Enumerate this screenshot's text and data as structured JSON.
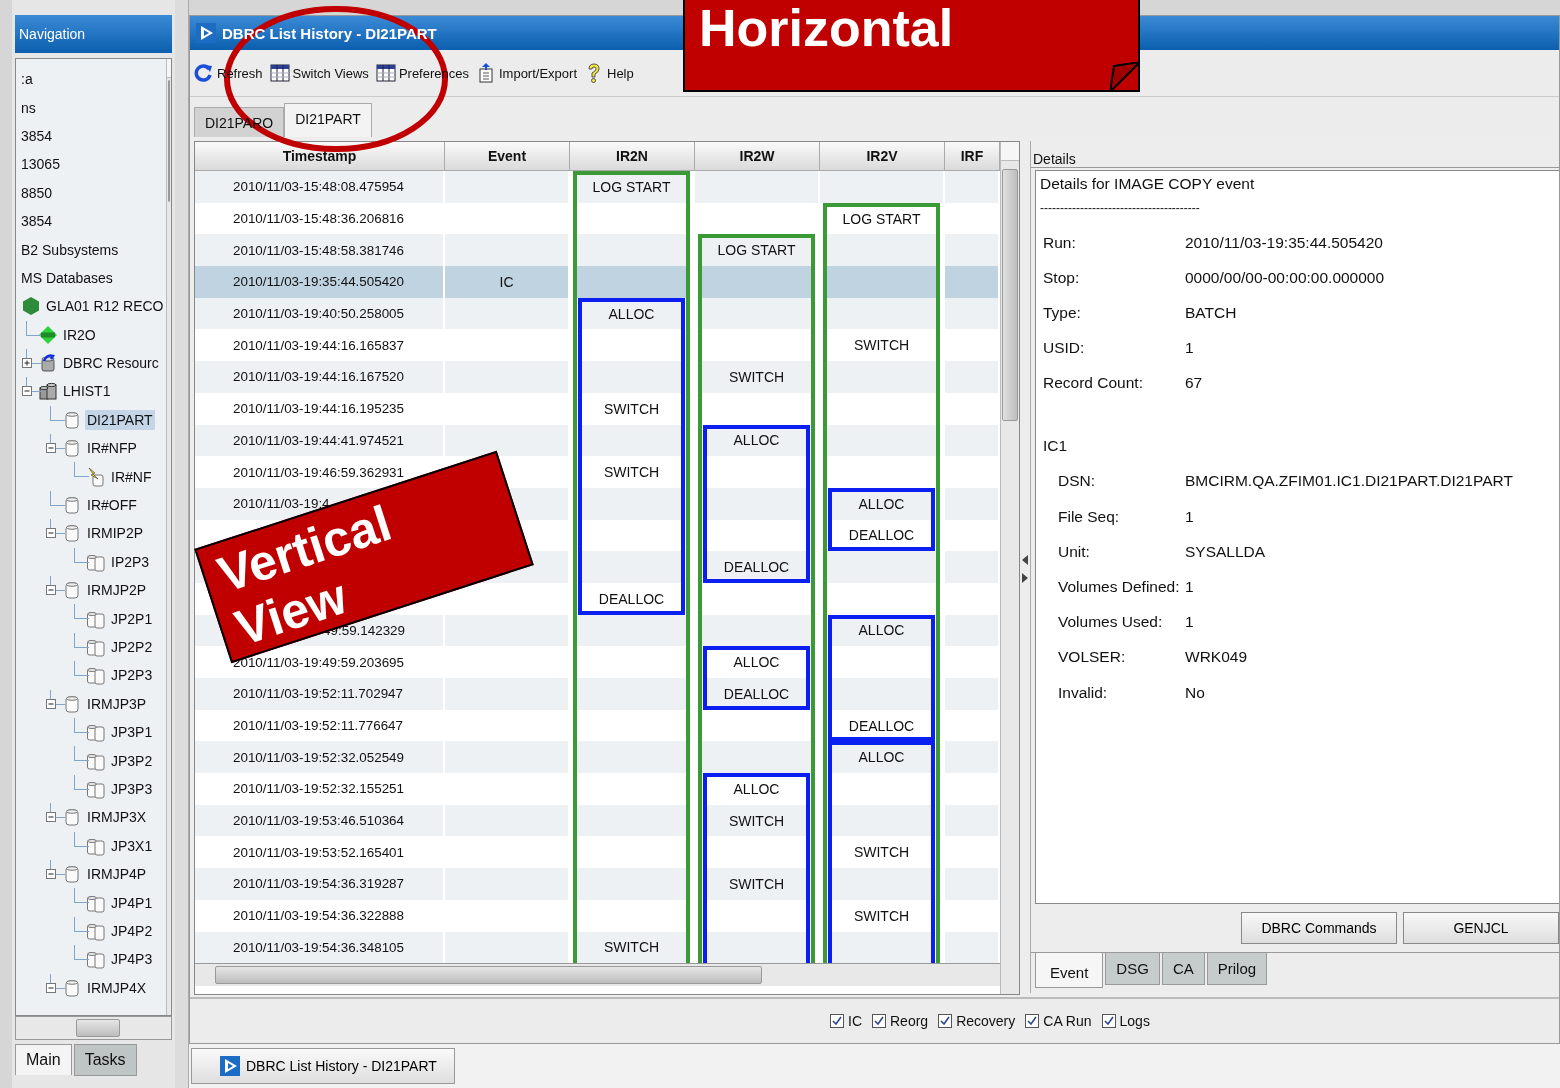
{
  "navigation": {
    "title": "Navigation",
    "tree": [
      {
        "label": ":a",
        "kind": "plain",
        "selected": false
      },
      {
        "label": "ns",
        "kind": "plain",
        "selected": false
      },
      {
        "label": "3854",
        "kind": "plain",
        "selected": false
      },
      {
        "label": "13065",
        "kind": "plain",
        "selected": false
      },
      {
        "label": "8850",
        "kind": "plain",
        "selected": false
      },
      {
        "label": "3854",
        "kind": "plain",
        "selected": false
      },
      {
        "label": "B2 Subsystems",
        "kind": "plain",
        "selected": false
      },
      {
        "label": "MS Databases",
        "kind": "plain",
        "selected": false
      },
      {
        "label": "GLA01 R12 RECO",
        "kind": "recon",
        "selected": false,
        "children": [
          {
            "label": "IR2O",
            "kind": "ims",
            "selected": false
          },
          {
            "label": "DBRC Resourc",
            "kind": "resource",
            "selected": false,
            "expanded": false
          },
          {
            "label": "LHIST1",
            "kind": "history",
            "selected": false,
            "expanded": true,
            "children": [
              {
                "label": "DI21PART",
                "kind": "database",
                "selected": true
              },
              {
                "label": "IR#NFP",
                "kind": "database",
                "selected": false,
                "expanded": true,
                "children": [
                  {
                    "label": "IR#NF",
                    "kind": "alert",
                    "selected": false
                  }
                ]
              },
              {
                "label": "IR#OFF",
                "kind": "database",
                "selected": false
              },
              {
                "label": "IRMIP2P",
                "kind": "database",
                "selected": false,
                "expanded": true,
                "children": [
                  {
                    "label": "IP2P3",
                    "kind": "dbset",
                    "selected": false
                  }
                ]
              },
              {
                "label": "IRMJP2P",
                "kind": "database",
                "selected": false,
                "expanded": true,
                "children": [
                  {
                    "label": "JP2P1",
                    "kind": "dbset",
                    "selected": false
                  },
                  {
                    "label": "JP2P2",
                    "kind": "dbset",
                    "selected": false
                  },
                  {
                    "label": "JP2P3",
                    "kind": "dbset",
                    "selected": false
                  }
                ]
              },
              {
                "label": "IRMJP3P",
                "kind": "database",
                "selected": false,
                "expanded": true,
                "children": [
                  {
                    "label": "JP3P1",
                    "kind": "dbset",
                    "selected": false
                  },
                  {
                    "label": "JP3P2",
                    "kind": "dbset",
                    "selected": false
                  },
                  {
                    "label": "JP3P3",
                    "kind": "dbset",
                    "selected": false
                  }
                ]
              },
              {
                "label": "IRMJP3X",
                "kind": "database",
                "selected": false,
                "expanded": true,
                "children": [
                  {
                    "label": "JP3X1",
                    "kind": "dbset",
                    "selected": false
                  }
                ]
              },
              {
                "label": "IRMJP4P",
                "kind": "database",
                "selected": false,
                "expanded": true,
                "children": [
                  {
                    "label": "JP4P1",
                    "kind": "dbset",
                    "selected": false
                  },
                  {
                    "label": "JP4P2",
                    "kind": "dbset",
                    "selected": false
                  },
                  {
                    "label": "JP4P3",
                    "kind": "dbset",
                    "selected": false
                  }
                ]
              },
              {
                "label": "IRMJP4X",
                "kind": "database",
                "selected": false,
                "expanded": true
              }
            ]
          }
        ]
      }
    ],
    "tabs": [
      {
        "label": "Main",
        "selected": true
      },
      {
        "label": "Tasks",
        "selected": false
      }
    ]
  },
  "window": {
    "title": "DBRC List History - DI21PART"
  },
  "toolbar": [
    {
      "label": "Refresh",
      "kind": "refresh"
    },
    {
      "label": "Switch Views",
      "kind": "views"
    },
    {
      "label": "Preferences",
      "kind": "preferences"
    },
    {
      "label": "Import/Export",
      "kind": "export"
    },
    {
      "label": "Help",
      "kind": "help"
    }
  ],
  "tabs": [
    {
      "label": "DI21PARO",
      "selected": false
    },
    {
      "label": "DI21PART",
      "selected": true
    }
  ],
  "table": {
    "columns": [
      "Timestamp",
      "Event",
      "IR2N",
      "IR2W",
      "IR2V",
      "IRF"
    ],
    "rows": [
      {
        "timestamp": "2010/11/03-15:48:08.475954",
        "selected": false
      },
      {
        "timestamp": "2010/11/03-15:48:36.206816",
        "selected": false
      },
      {
        "timestamp": "2010/11/03-15:48:58.381746",
        "selected": false
      },
      {
        "timestamp": "2010/11/03-19:35:44.505420",
        "event": "IC",
        "selected": true
      },
      {
        "timestamp": "2010/11/03-19:40:50.258005",
        "selected": false
      },
      {
        "timestamp": "2010/11/03-19:44:16.165837",
        "selected": false
      },
      {
        "timestamp": "2010/11/03-19:44:16.167520",
        "selected": false
      },
      {
        "timestamp": "2010/11/03-19:44:16.195235",
        "selected": false
      },
      {
        "timestamp": "2010/11/03-19:44:41.974521",
        "selected": false
      },
      {
        "timestamp": "2010/11/03-19:46:59.362931",
        "selected": false
      },
      {
        "timestamp": "2010/11/03-19:4",
        "selected": false
      },
      {
        "kind": "hidden"
      },
      {
        "kind": "hidden"
      },
      {
        "kind": "hidden"
      },
      {
        "timestamp": "49:59.142329",
        "kind": "tail",
        "selected": false
      },
      {
        "timestamp": "2010/11/03-19:49:59.203695",
        "selected": false
      },
      {
        "timestamp": "2010/11/03-19:52:11.702947",
        "selected": false
      },
      {
        "timestamp": "2010/11/03-19:52:11.776647",
        "selected": false
      },
      {
        "timestamp": "2010/11/03-19:52:32.052549",
        "selected": false
      },
      {
        "timestamp": "2010/11/03-19:52:32.155251",
        "selected": false
      },
      {
        "timestamp": "2010/11/03-19:53:46.510364",
        "selected": false
      },
      {
        "timestamp": "2010/11/03-19:53:52.165401",
        "selected": false
      },
      {
        "timestamp": "2010/11/03-19:54:36.319287",
        "selected": false
      },
      {
        "timestamp": "2010/11/03-19:54:36.322888",
        "selected": false
      },
      {
        "timestamp": "2010/11/03-19:54:36.348105",
        "selected": false
      }
    ],
    "lanes": [
      {
        "items": [
          {
            "kind": "log",
            "continues": true,
            "items": [
              {
                "kind": "event",
                "text": "LOG START"
              },
              {
                "kind": "empty"
              },
              {
                "kind": "empty"
              },
              {
                "kind": "empty"
              },
              {
                "kind": "alloc",
                "continues": false,
                "items": [
                  {
                    "kind": "event",
                    "text": "ALLOC"
                  },
                  {
                    "kind": "empty"
                  },
                  {
                    "kind": "empty"
                  },
                  {
                    "kind": "event",
                    "text": "SWITCH"
                  },
                  {
                    "kind": "empty"
                  },
                  {
                    "kind": "event",
                    "text": "SWITCH"
                  },
                  {
                    "kind": "empty"
                  },
                  {
                    "kind": "empty"
                  },
                  {
                    "kind": "empty"
                  },
                  {
                    "kind": "event",
                    "text": "DEALLOC"
                  }
                ]
              },
              {
                "kind": "empty"
              },
              {
                "kind": "empty"
              },
              {
                "kind": "empty"
              },
              {
                "kind": "empty"
              },
              {
                "kind": "empty"
              },
              {
                "kind": "empty"
              },
              {
                "kind": "empty"
              },
              {
                "kind": "empty"
              },
              {
                "kind": "empty"
              },
              {
                "kind": "empty"
              },
              {
                "kind": "event",
                "text": "SWITCH"
              }
            ]
          }
        ]
      },
      {
        "items": [
          {
            "kind": "empty"
          },
          {
            "kind": "empty"
          },
          {
            "kind": "log",
            "continues": true,
            "items": [
              {
                "kind": "event",
                "text": "LOG START"
              },
              {
                "kind": "empty"
              },
              {
                "kind": "empty"
              },
              {
                "kind": "empty"
              },
              {
                "kind": "event",
                "text": "SWITCH"
              },
              {
                "kind": "empty"
              },
              {
                "kind": "alloc",
                "continues": false,
                "items": [
                  {
                    "kind": "event",
                    "text": "ALLOC"
                  },
                  {
                    "kind": "empty"
                  },
                  {
                    "kind": "empty"
                  },
                  {
                    "kind": "empty"
                  },
                  {
                    "kind": "event",
                    "text": "DEALLOC"
                  }
                ]
              },
              {
                "kind": "empty"
              },
              {
                "kind": "empty"
              },
              {
                "kind": "alloc",
                "continues": false,
                "items": [
                  {
                    "kind": "event",
                    "text": "ALLOC"
                  },
                  {
                    "kind": "event",
                    "text": "DEALLOC"
                  }
                ]
              },
              {
                "kind": "empty"
              },
              {
                "kind": "empty"
              },
              {
                "kind": "alloc",
                "continues": true,
                "items": [
                  {
                    "kind": "event",
                    "text": "ALLOC"
                  },
                  {
                    "kind": "event",
                    "text": "SWITCH"
                  },
                  {
                    "kind": "empty"
                  },
                  {
                    "kind": "event",
                    "text": "SWITCH"
                  },
                  {
                    "kind": "empty"
                  },
                  {
                    "kind": "empty"
                  }
                ]
              }
            ]
          }
        ]
      },
      {
        "items": [
          {
            "kind": "empty"
          },
          {
            "kind": "log",
            "continues": true,
            "items": [
              {
                "kind": "event",
                "text": "LOG START"
              },
              {
                "kind": "empty"
              },
              {
                "kind": "empty"
              },
              {
                "kind": "empty"
              },
              {
                "kind": "event",
                "text": "SWITCH"
              },
              {
                "kind": "empty"
              },
              {
                "kind": "empty"
              },
              {
                "kind": "empty"
              },
              {
                "kind": "empty"
              },
              {
                "kind": "alloc",
                "continues": false,
                "items": [
                  {
                    "kind": "event",
                    "text": "ALLOC"
                  },
                  {
                    "kind": "event",
                    "text": "DEALLOC"
                  }
                ]
              },
              {
                "kind": "empty"
              },
              {
                "kind": "empty"
              },
              {
                "kind": "alloc",
                "continues": false,
                "items": [
                  {
                    "kind": "event",
                    "text": "ALLOC"
                  },
                  {
                    "kind": "empty"
                  },
                  {
                    "kind": "empty"
                  },
                  {
                    "kind": "event",
                    "text": "DEALLOC"
                  }
                ]
              },
              {
                "kind": "alloc",
                "continues": true,
                "items": [
                  {
                    "kind": "event",
                    "text": "ALLOC"
                  },
                  {
                    "kind": "empty"
                  },
                  {
                    "kind": "empty"
                  },
                  {
                    "kind": "event",
                    "text": "SWITCH"
                  },
                  {
                    "kind": "empty"
                  },
                  {
                    "kind": "event",
                    "text": "SWITCH"
                  },
                  {
                    "kind": "empty"
                  }
                ]
              }
            ]
          }
        ]
      }
    ]
  },
  "details": {
    "title": "Details",
    "heading": "Details for IMAGE COPY event",
    "rule": "----------------------------------------",
    "fields": [
      {
        "label": "Run:",
        "value": "2010/11/03-19:35:44.505420"
      },
      {
        "label": "Stop:",
        "value": "0000/00/00-00:00:00.000000"
      },
      {
        "label": "Type:",
        "value": "BATCH"
      },
      {
        "label": "USID:",
        "value": "1"
      },
      {
        "label": "Record Count:",
        "value": "67"
      }
    ],
    "group": {
      "title": "IC1",
      "fields": [
        {
          "label": "DSN:",
          "value": "BMCIRM.QA.ZFIM01.IC1.DI21PART.DI21PART"
        },
        {
          "label": "File Seq:",
          "value": "1"
        },
        {
          "label": "Unit:",
          "value": "SYSALLDA"
        },
        {
          "label": "Volumes Defined:",
          "value": "1"
        },
        {
          "label": "Volumes Used:",
          "value": "1"
        },
        {
          "label": "VOLSER:",
          "value": "WRK049"
        },
        {
          "label": "Invalid:",
          "value": "No"
        }
      ]
    },
    "buttons": [
      "DBRC Commands",
      "GENJCL"
    ],
    "tabs": [
      {
        "label": "Event",
        "selected": true
      },
      {
        "label": "DSG",
        "selected": false
      },
      {
        "label": "CA",
        "selected": false
      },
      {
        "label": "Prilog",
        "selected": false
      }
    ]
  },
  "filters": [
    {
      "label": "IC",
      "checked": true
    },
    {
      "label": "Reorg",
      "checked": true
    },
    {
      "label": "Recovery",
      "checked": true
    },
    {
      "label": "CA Run",
      "checked": true
    },
    {
      "label": "Logs",
      "checked": true
    }
  ],
  "taskbar": {
    "label": "DBRC List History - DI21PART"
  },
  "annotations": [
    {
      "kind": "banner",
      "text": "Horizontal"
    },
    {
      "kind": "ellipse"
    },
    {
      "kind": "tag",
      "text": "Vertical View"
    }
  ]
}
